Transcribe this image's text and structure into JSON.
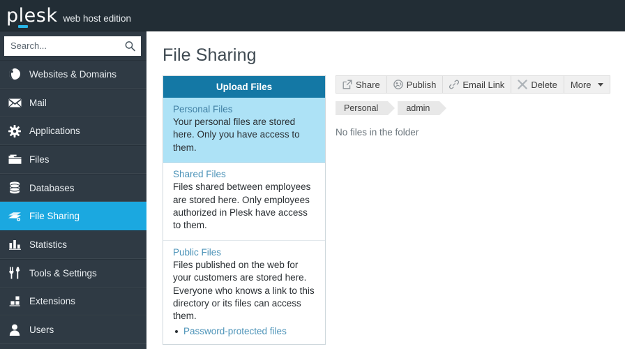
{
  "header": {
    "logo_text": "plesk",
    "edition": "web host edition",
    "accent_color": "#2ab6e8",
    "background_color": "#222d35"
  },
  "search": {
    "placeholder": "Search...",
    "value": "",
    "icon": "search-icon"
  },
  "sidebar": {
    "background_color": "#2f3a44",
    "active_color": "#1ba8e0",
    "items": [
      {
        "label": "Websites & Domains",
        "icon": "globe-icon",
        "active": false
      },
      {
        "label": "Mail",
        "icon": "envelope-icon",
        "active": false
      },
      {
        "label": "Applications",
        "icon": "gear-icon",
        "active": false
      },
      {
        "label": "Files",
        "icon": "folder-icon",
        "active": false
      },
      {
        "label": "Databases",
        "icon": "database-icon",
        "active": false
      },
      {
        "label": "File Sharing",
        "icon": "file-sharing-icon",
        "active": true
      },
      {
        "label": "Statistics",
        "icon": "bar-chart-icon",
        "active": false
      },
      {
        "label": "Tools & Settings",
        "icon": "fork-knife-icon",
        "active": false
      },
      {
        "label": "Extensions",
        "icon": "blocks-icon",
        "active": false
      },
      {
        "label": "Users",
        "icon": "user-icon",
        "active": false
      }
    ]
  },
  "main": {
    "page_title": "File Sharing",
    "upload_button": "Upload Files",
    "folders": [
      {
        "name": "Personal Files",
        "description": "Your personal files are stored here. Only you have access to them.",
        "selected": true
      },
      {
        "name": "Shared Files",
        "description": "Files shared between employees are stored here. Only employees authorized in Plesk have access to them.",
        "selected": false
      },
      {
        "name": "Public Files",
        "description": "Files published on the web for your customers are stored here. Everyone who knows a link to this directory or its files can access them.",
        "selected": false,
        "links": [
          "Password-protected files"
        ]
      }
    ],
    "toolbar": [
      {
        "label": "Share",
        "icon": "share-icon"
      },
      {
        "label": "Publish",
        "icon": "publish-icon"
      },
      {
        "label": "Email Link",
        "icon": "link-icon"
      },
      {
        "label": "Delete",
        "icon": "delete-icon"
      },
      {
        "label": "More",
        "icon": "chevron-down-icon"
      }
    ],
    "breadcrumb": [
      "Personal",
      "admin"
    ],
    "empty_message": "No files in the folder"
  }
}
